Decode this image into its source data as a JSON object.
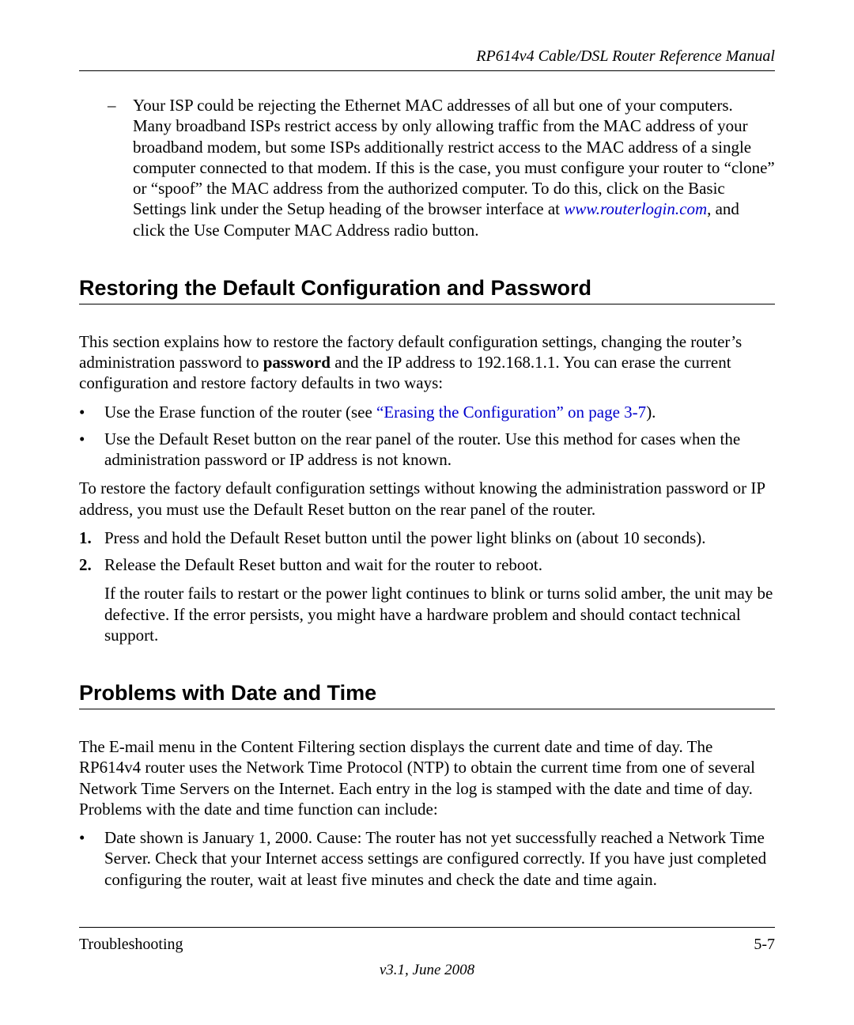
{
  "header": {
    "title": "RP614v4 Cable/DSL Router Reference Manual"
  },
  "mac_item": {
    "text_before_link": "Your ISP could be rejecting the Ethernet MAC addresses of all but one of your computers. Many broadband ISPs restrict access by only allowing traffic from the MAC address of your broadband modem, but some ISPs additionally restrict access to the MAC address of a single computer connected to that modem. If this is the case, you must configure your router to “clone” or “spoof” the MAC address from the authorized computer. To do this, click on the Basic Settings link under the Setup heading of the browser interface at ",
    "link": "www.routerlogin.com",
    "text_after_link": ", and click the Use Computer MAC Address radio button."
  },
  "section1": {
    "heading": "Restoring the Default Configuration and Password",
    "intro_before_bold": "This section explains how to restore the factory default configuration settings, changing the router’s administration password to ",
    "intro_bold": "password",
    "intro_after_bold": " and the IP address to 192.168.1.1. You can erase the current configuration and restore factory defaults in two ways:",
    "bullet1_before_link": "Use the Erase function of the router (see ",
    "bullet1_link": "“Erasing the Configuration” on page 3-7",
    "bullet1_after_link": ").",
    "bullet2": "Use the Default Reset button on the rear panel of the router. Use this method for cases when the administration password or IP address is not known.",
    "para2": "To restore the factory default configuration settings without knowing the administration password or IP address, you must use the Default Reset button on the rear panel of the router.",
    "step1_num": "1.",
    "step1": "Press and hold the Default Reset button until the power light blinks on (about 10 seconds).",
    "step2_num": "2.",
    "step2": "Release the Default Reset button and wait for the router to reboot.",
    "step2_extra": "If the router fails to restart or the power light continues to blink or turns solid amber, the unit may be defective. If the error persists, you might have a hardware problem and should contact technical support."
  },
  "section2": {
    "heading": "Problems with Date and Time",
    "intro": "The E-mail menu in the Content Filtering section displays the current date and time of day. The RP614v4 router uses the Network Time Protocol (NTP) to obtain the current time from one of several Network Time Servers on the Internet. Each entry in the log is stamped with the date and time of day. Problems with the date and time function can include:",
    "bullet1": "Date shown is January 1, 2000. Cause: The router has not yet successfully reached a Network Time Server. Check that your Internet access settings are configured correctly. If you have just completed configuring the router, wait at least five minutes and check the date and time again."
  },
  "footer": {
    "left": "Troubleshooting",
    "right": "5-7",
    "version": "v3.1, June 2008"
  }
}
